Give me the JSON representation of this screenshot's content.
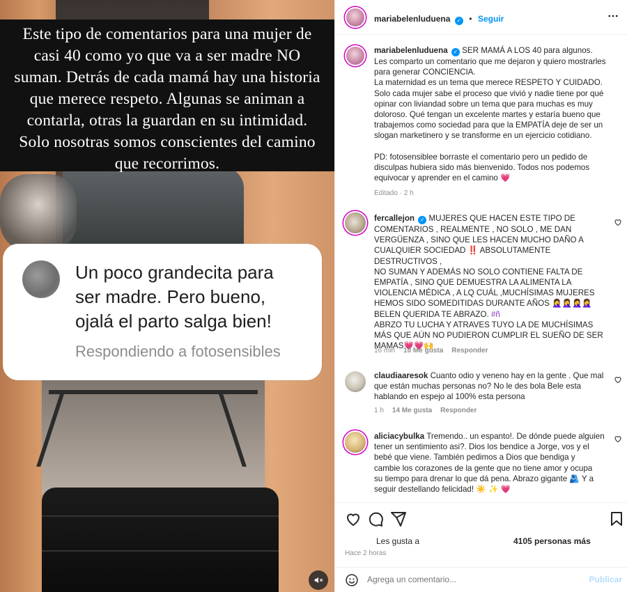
{
  "media": {
    "caption": "Este tipo de comentarios para una mujer de\ncasi 40 como yo que va a ser madre NO\nsuman. Detrás de cada mamá hay una historia\nque merece respeto. Algunas se animan a\ncontarla, otras la guardan en su intimidad.\nSolo nosotras somos conscientes del camino\nque recorrimos.",
    "comment_card": {
      "text": "Un poco grandecita para\nser madre. Pero bueno,\nojalá el parto salga bien!",
      "sub": "Respondiendo a fotosensibles"
    },
    "mute_icon": "speaker-muted-icon"
  },
  "header": {
    "username": "mariabelenluduena",
    "follow_label": "Seguir",
    "verified_icon": "verified-badge-icon",
    "more_icon": "more-horizontal-icon"
  },
  "post": {
    "username": "mariabelenluduena",
    "text": "SER MAMÁ A LOS 40 para algunos.\nLes comparto un comentario que me dejaron y quiero mostrarles\npara generar CONCIENCIA.\nLa maternidad es un tema que merece RESPETO Y CUIDADO.\nSolo cada mujer sabe el proceso que vivió y nadie tiene por qué\nopinar con liviandad sobre un tema que para muchas es muy\ndoloroso. Qué tengan un excelente martes y estaría bueno que\ntrabajemos como sociedad para que la EMPATÍA deje de ser un\nslogan marketinero y se transforme en un ejercicio cotidiano.\n\nPD: fotosensiblee borraste el comentario pero un pedido de\ndisculpas hubiera sido más bienvenido. Todos nos podemos\nequivocar y aprender en el camino 💗",
    "edited": "Editado · 2 h"
  },
  "comments": [
    {
      "username": "fercallejon",
      "verified": true,
      "text": "MUJERES QUE HACEN ESTE TIPO DE\nCOMENTARIOS , REALMENTE , NO SOLO , ME DAN\nVERGÜENZA , SINO QUE LES HACEN MUCHO DAÑO A\nCUALQUIER SOCIEDAD ‼️ ABSOLUTAMENTE DESTRUCTIVOS ,\nNO SUMAN Y ADEMÁS NO SOLO CONTIENE FALTA DE\nEMPATÍA , SINO QUE DEMUESTRA LA ALIMENTA LA\nVIOLENCIA MÉDICA , A LQ CUÁL ,MUCHÍSIMAS MUJERES\nHEMOS SIDO SOMEDITIDAS DURANTE AÑOS 🤦‍♀️🤦‍♀️🤦‍♀️🤦‍♀️\nBELEN QUERIDA TE ABRAZO.",
      "hashtag": "#ñ",
      "text2": "ABRZO TU LUCHA Y ATRAVES TUYO LA DE MUCHÍSIMAS\nMÁS QUE AÚN NO PUDIERON CUMPLIR EL SUEÑO DE SER\nMAMAS💗💗🙌",
      "time": "16 min",
      "likes": "10 Me gusta",
      "reply": "Responder"
    },
    {
      "username": "claudiaaresok",
      "verified": false,
      "text": "Cuanto odio y veneno hay en la gente . Que mal\nque están muchas personas no? No le des bola Bele esta\nhablando en espejo al 100% esta persona",
      "time": "1 h",
      "likes": "14 Me gusta",
      "reply": "Responder"
    },
    {
      "username": "aliciacybulka",
      "verified": false,
      "text": "Tremendo.. un espanto!. De dónde puede alguien\ntener un sentimiento asi?. Dios los bendice a Jorge, vos y el\nbebé que viene. También pedimos a Dios que bendiga y\ncambie los corazones de la gente que no tiene amor y ocupa\nsu tiempo para drenar lo que dá pena. Abrazo gigante 🫂 Y a\nseguir destellando felicidad! ☀️ ✨ 💗"
    }
  ],
  "actions": {
    "icons": [
      "heart-icon",
      "comment-icon",
      "share-icon",
      "bookmark-icon"
    ],
    "likes_prefix": "Les gusta a",
    "likes_count": "4105 personas más",
    "time": "Hace 2 horas"
  },
  "add_comment": {
    "placeholder": "Agrega un comentario...",
    "publish_label": "Publicar",
    "emoji_icon": "emoji-icon"
  },
  "colors": {
    "accent": "#0095f6",
    "publish_disabled": "#b2dffc",
    "hashtag": "#8a3ab9",
    "heart": "#ed4956"
  }
}
